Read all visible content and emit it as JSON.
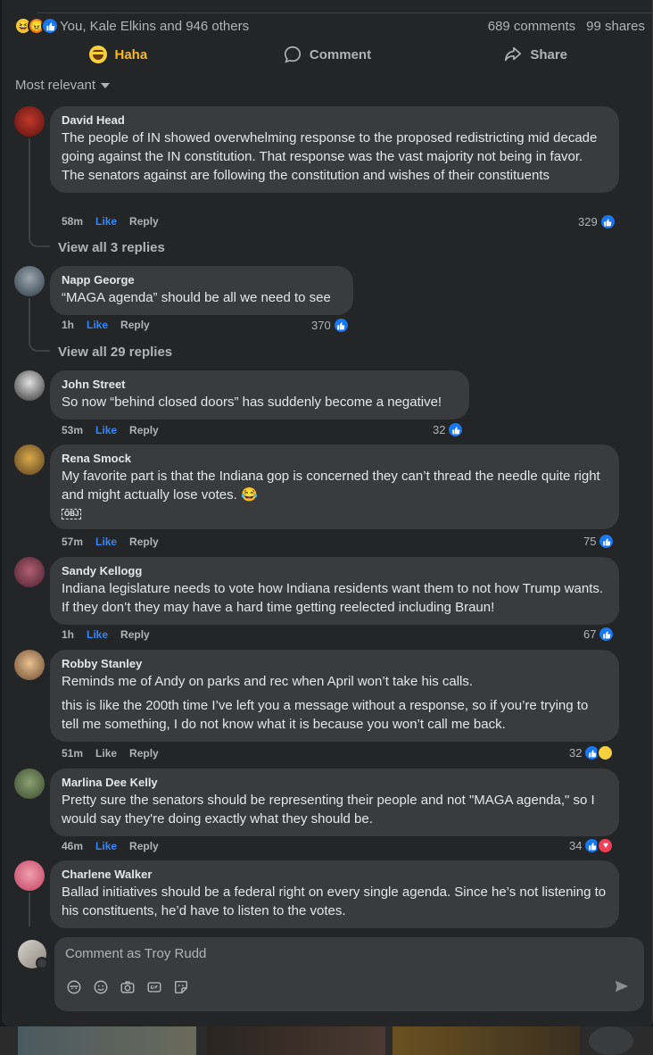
{
  "post": {
    "reactions_text": "You, Kale Elkins and 946 others",
    "comments_count": "689 comments",
    "shares_count": "99 shares",
    "reaction_icons": [
      "haha-icon",
      "angry-icon",
      "like-icon"
    ]
  },
  "actions": {
    "haha": "Haha",
    "comment": "Comment",
    "share": "Share"
  },
  "sort": {
    "label": "Most relevant"
  },
  "comments": [
    {
      "author": "David Head",
      "text": [
        "The people of IN showed overwhelming response to the proposed redistricting mid decade going against the IN constitution. That response was the vast majority not being in favor. The senators against are following the constitution and wishes of their constituents"
      ],
      "time": "58m",
      "like": "Like",
      "reply": "Reply",
      "reactions": "329",
      "view_replies": "View all 3 replies"
    },
    {
      "author": "Napp George",
      "text": [
        "“MAGA agenda” should be all we need to see"
      ],
      "time": "1h",
      "like": "Like",
      "reply": "Reply",
      "reactions": "370",
      "view_replies": "View all 29 replies"
    },
    {
      "author": "John Street",
      "text": [
        "So now “behind closed doors” has suddenly become a negative!"
      ],
      "time": "53m",
      "like": "Like",
      "reply": "Reply",
      "reactions": "32"
    },
    {
      "author": "Rena Smock",
      "text": [
        "My favorite part is that the Indiana gop is concerned they can’t thread the needle quite right and might actually lose votes. 😂"
      ],
      "attachment": "OBJ",
      "time": "57m",
      "like": "Like",
      "reply": "Reply",
      "reactions": "75"
    },
    {
      "author": "Sandy Kellogg",
      "text": [
        "Indiana legislature needs to vote how Indiana residents want them to not how Trump wants. If they don’t they may have a hard time getting reelected including Braun!"
      ],
      "time": "1h",
      "like": "Like",
      "reply": "Reply",
      "reactions": "67"
    },
    {
      "author": "Robby Stanley",
      "text": [
        "Reminds me of Andy on parks and rec when April won’t take his calls.",
        "this is like the 200th time I’ve left you a message without a response, so if you’re trying to tell me something, I do not know what it is because you won’t call me back."
      ],
      "time": "51m",
      "like": "Like",
      "reply": "Reply",
      "reactions": "32"
    },
    {
      "author": "Marlina Dee Kelly",
      "text": [
        "Pretty sure the senators should be representing their people and not \"MAGA agenda,\" so I would say they're doing exactly what they should be."
      ],
      "time": "46m",
      "like": "Like",
      "reply": "Reply",
      "reactions": "34"
    },
    {
      "author": "Charlene Walker",
      "text": [
        "Ballad initiatives should be a federal right on every single agenda. Since he’s not listening to his constituents, he’d have to listen to the votes."
      ]
    }
  ],
  "composer": {
    "placeholder": "Comment as Troy Rudd"
  },
  "colors": {
    "background": "#242526",
    "bubble": "#3a3b3c",
    "text": "#e4e6eb",
    "muted": "#b0b3b8",
    "link_blue": "#2d88ff",
    "haha_yellow": "#f7b928"
  }
}
